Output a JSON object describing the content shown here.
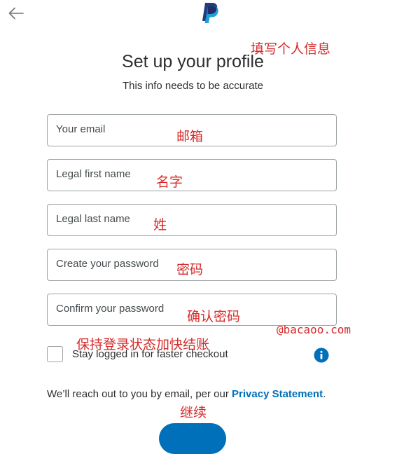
{
  "header": {
    "back_icon": "arrow-left-icon",
    "logo_icon": "paypal-logo-icon",
    "brand_colors": {
      "dark": "#253b80",
      "light": "#179bd7",
      "primary": "#0070ba"
    }
  },
  "page": {
    "title": "Set up your profile",
    "subtitle": "This info needs to be accurate"
  },
  "form": {
    "email_placeholder": "Your email",
    "first_name_placeholder": "Legal first name",
    "last_name_placeholder": "Legal last name",
    "password_placeholder": "Create your password",
    "confirm_password_placeholder": "Confirm your password",
    "stay_logged_in_label": "Stay logged in for faster checkout",
    "info_icon": "info-icon"
  },
  "footer": {
    "disclaimer_prefix": "We’ll reach out to you by email, per our ",
    "privacy_link": "Privacy Statement",
    "disclaimer_suffix": "."
  },
  "annotations": {
    "title_note": "填写个人信息",
    "email_note": "邮箱",
    "first_name_note": "名字",
    "last_name_note": "姓",
    "password_note": "密码",
    "confirm_password_note": "确认密码",
    "stay_logged_in_note": "保持登录状态加快结账",
    "continue_note": "继续",
    "watermark": "@bacaoo.com",
    "color": "#d62b2b"
  }
}
